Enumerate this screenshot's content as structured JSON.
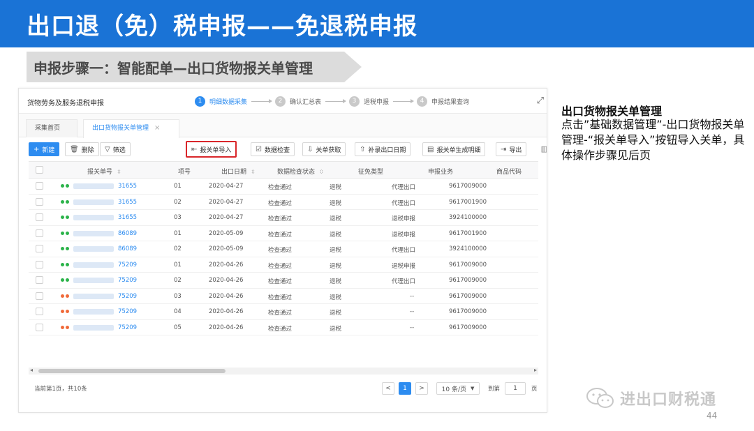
{
  "slide": {
    "title": "出口退（免）税申报——免退税申报",
    "step_banner": "申报步骤一：智能配单—出口货物报关单管理",
    "page_number": "44"
  },
  "app": {
    "title": "货物劳务及服务退税申报",
    "steps": [
      {
        "num": "1",
        "label": "明细数据采集",
        "active": true
      },
      {
        "num": "2",
        "label": "确认汇总表",
        "active": false
      },
      {
        "num": "3",
        "label": "退税申报",
        "active": false
      },
      {
        "num": "4",
        "label": "申报结果查询",
        "active": false
      }
    ],
    "expand_icon": "expand-icon",
    "tabs": [
      {
        "label": "采集首页"
      },
      {
        "label": "出口货物报关单管理",
        "close": "×"
      }
    ],
    "toolbar": {
      "new": "新建",
      "delete": "删除",
      "filter": "筛选",
      "import": "报关单导入",
      "check": "数据检查",
      "fetch": "关单获取",
      "supplement": "补录出口日期",
      "generate": "报关单生成明细",
      "export": "导出"
    },
    "columns": [
      "报关单号",
      "项号",
      "出口日期",
      "数据检查状态",
      "征免类型",
      "申报业务",
      "商品代码"
    ],
    "rows": [
      {
        "dots": [
          "#2bb34a",
          "#2bb34a"
        ],
        "no": "31655",
        "item": "01",
        "date": "2020-04-27",
        "check": "检查通过",
        "type": "退税",
        "biz": "代理出口",
        "code": "9617009000"
      },
      {
        "dots": [
          "#2bb34a",
          "#2bb34a"
        ],
        "no": "31655",
        "item": "02",
        "date": "2020-04-27",
        "check": "检查通过",
        "type": "退税",
        "biz": "代理出口",
        "code": "9617001900"
      },
      {
        "dots": [
          "#2bb34a",
          "#2bb34a"
        ],
        "no": "31655",
        "item": "03",
        "date": "2020-04-27",
        "check": "检查通过",
        "type": "退税",
        "biz": "退税申报",
        "code": "3924100000"
      },
      {
        "dots": [
          "#2bb34a",
          "#2bb34a"
        ],
        "no": "86089",
        "item": "01",
        "date": "2020-05-09",
        "check": "检查通过",
        "type": "退税",
        "biz": "退税申报",
        "code": "9617001900"
      },
      {
        "dots": [
          "#2bb34a",
          "#2bb34a"
        ],
        "no": "86089",
        "item": "02",
        "date": "2020-05-09",
        "check": "检查通过",
        "type": "退税",
        "biz": "代理出口",
        "code": "3924100000"
      },
      {
        "dots": [
          "#2bb34a",
          "#2bb34a"
        ],
        "no": "75209",
        "item": "01",
        "date": "2020-04-26",
        "check": "检查通过",
        "type": "退税",
        "biz": "退税申报",
        "code": "9617009000"
      },
      {
        "dots": [
          "#2bb34a",
          "#2bb34a"
        ],
        "no": "75209",
        "item": "02",
        "date": "2020-04-26",
        "check": "检查通过",
        "type": "退税",
        "biz": "代理出口",
        "code": "9617009000"
      },
      {
        "dots": [
          "#f06a3a",
          "#f06a3a"
        ],
        "no": "75209",
        "item": "03",
        "date": "2020-04-26",
        "check": "检查通过",
        "type": "退税",
        "biz": "--",
        "code": "9617009000"
      },
      {
        "dots": [
          "#f06a3a",
          "#f06a3a"
        ],
        "no": "75209",
        "item": "04",
        "date": "2020-04-26",
        "check": "检查通过",
        "type": "退税",
        "biz": "--",
        "code": "9617009000"
      },
      {
        "dots": [
          "#f06a3a",
          "#f06a3a"
        ],
        "no": "75209",
        "item": "05",
        "date": "2020-04-26",
        "check": "检查通过",
        "type": "退税",
        "biz": "--",
        "code": "9617009000"
      }
    ],
    "footer": {
      "info": "当前第1页，共10条",
      "prev": "<",
      "page": "1",
      "next": ">",
      "page_size": "10 条/页",
      "goto_label": "到第",
      "goto_value": "1",
      "goto_suffix": "页"
    }
  },
  "description": {
    "title": "出口货物报关单管理",
    "body": "点击”基础数据管理”-出口货物报关单管理-“报关单导入”按钮导入关单，具体操作步骤见后页"
  },
  "watermark": {
    "text": "进出口财税通"
  },
  "colors": {
    "header_blue": "#1a73d6",
    "accent_blue": "#2d8cf0",
    "highlight_red": "#d9262a",
    "ok_green": "#2bb34a",
    "warn_orange": "#f06a3a"
  }
}
